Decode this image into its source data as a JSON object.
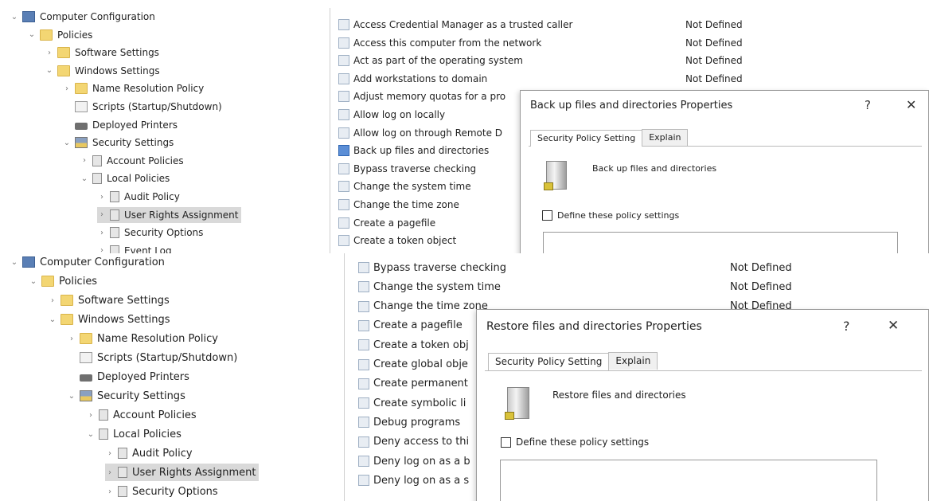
{
  "top": {
    "tree": [
      {
        "label": "Computer Configuration",
        "chev": "⌄",
        "icon": "comp"
      },
      {
        "label": "Policies",
        "chev": "⌄",
        "icon": "folder"
      },
      {
        "label": "Software Settings",
        "chev": "›",
        "icon": "folder"
      },
      {
        "label": "Windows Settings",
        "chev": "⌄",
        "icon": "folder"
      },
      {
        "label": "Name Resolution Policy",
        "chev": "›",
        "icon": "folder"
      },
      {
        "label": "Scripts (Startup/Shutdown)",
        "chev": "",
        "icon": "script"
      },
      {
        "label": "Deployed Printers",
        "chev": "",
        "icon": "printer"
      },
      {
        "label": "Security Settings",
        "chev": "⌄",
        "icon": "sec"
      },
      {
        "label": "Account Policies",
        "chev": "›",
        "icon": "pol"
      },
      {
        "label": "Local Policies",
        "chev": "⌄",
        "icon": "pol"
      },
      {
        "label": "Audit Policy",
        "chev": "›",
        "icon": "pol"
      },
      {
        "label": "User Rights Assignment",
        "chev": "›",
        "icon": "pol",
        "selected": true
      },
      {
        "label": "Security Options",
        "chev": "›",
        "icon": "pol"
      },
      {
        "label": "Event Log",
        "chev": "›",
        "icon": "pol"
      }
    ],
    "policies": [
      {
        "name": "Access Credential Manager as a trusted caller",
        "setting": "Not Defined"
      },
      {
        "name": "Access this computer from the network",
        "setting": "Not Defined"
      },
      {
        "name": "Act as part of the operating system",
        "setting": "Not Defined"
      },
      {
        "name": "Add workstations to domain",
        "setting": "Not Defined"
      },
      {
        "name": "Adjust memory quotas for a pro",
        "setting": ""
      },
      {
        "name": "Allow log on locally",
        "setting": ""
      },
      {
        "name": "Allow log on through Remote D",
        "setting": ""
      },
      {
        "name": "Back up files and directories",
        "setting": "",
        "active": true
      },
      {
        "name": "Bypass traverse checking",
        "setting": ""
      },
      {
        "name": "Change the system time",
        "setting": ""
      },
      {
        "name": "Change the time zone",
        "setting": ""
      },
      {
        "name": "Create a pagefile",
        "setting": ""
      },
      {
        "name": "Create a token object",
        "setting": ""
      }
    ],
    "dialog": {
      "title": "Back up files and directories Properties",
      "help": "?",
      "close": "✕",
      "tabs": [
        "Security Policy Setting",
        "Explain"
      ],
      "policy_name": "Back up files and directories",
      "checkbox_label": "Define these policy settings"
    }
  },
  "bottom": {
    "tree": [
      {
        "label": "Computer Configuration",
        "chev": "⌄",
        "icon": "comp"
      },
      {
        "label": "Policies",
        "chev": "⌄",
        "icon": "folder"
      },
      {
        "label": "Software Settings",
        "chev": "›",
        "icon": "folder"
      },
      {
        "label": "Windows Settings",
        "chev": "⌄",
        "icon": "folder"
      },
      {
        "label": "Name Resolution Policy",
        "chev": "›",
        "icon": "folder"
      },
      {
        "label": "Scripts (Startup/Shutdown)",
        "chev": "",
        "icon": "script"
      },
      {
        "label": "Deployed Printers",
        "chev": "",
        "icon": "printer"
      },
      {
        "label": "Security Settings",
        "chev": "⌄",
        "icon": "sec"
      },
      {
        "label": "Account Policies",
        "chev": "›",
        "icon": "pol"
      },
      {
        "label": "Local Policies",
        "chev": "⌄",
        "icon": "pol"
      },
      {
        "label": "Audit Policy",
        "chev": "›",
        "icon": "pol"
      },
      {
        "label": "User Rights Assignment",
        "chev": "›",
        "icon": "pol",
        "selected": true
      },
      {
        "label": "Security Options",
        "chev": "›",
        "icon": "pol"
      }
    ],
    "policies": [
      {
        "name": "Bypass traverse checking",
        "setting": "Not Defined"
      },
      {
        "name": "Change the system time",
        "setting": "Not Defined"
      },
      {
        "name": "Change the time zone",
        "setting": "Not Defined"
      },
      {
        "name": "Create a pagefile",
        "setting": ""
      },
      {
        "name": "Create a token obj",
        "setting": ""
      },
      {
        "name": "Create global obje",
        "setting": ""
      },
      {
        "name": "Create permanent",
        "setting": ""
      },
      {
        "name": "Create symbolic li",
        "setting": ""
      },
      {
        "name": "Debug programs",
        "setting": ""
      },
      {
        "name": "Deny access to thi",
        "setting": ""
      },
      {
        "name": "Deny log on as a b",
        "setting": ""
      },
      {
        "name": "Deny log on as a s",
        "setting": ""
      }
    ],
    "dialog": {
      "title": "Restore files and directories Properties",
      "help": "?",
      "close": "✕",
      "tabs": [
        "Security Policy Setting",
        "Explain"
      ],
      "policy_name": "Restore files and directories",
      "checkbox_label": "Define these policy settings"
    }
  }
}
